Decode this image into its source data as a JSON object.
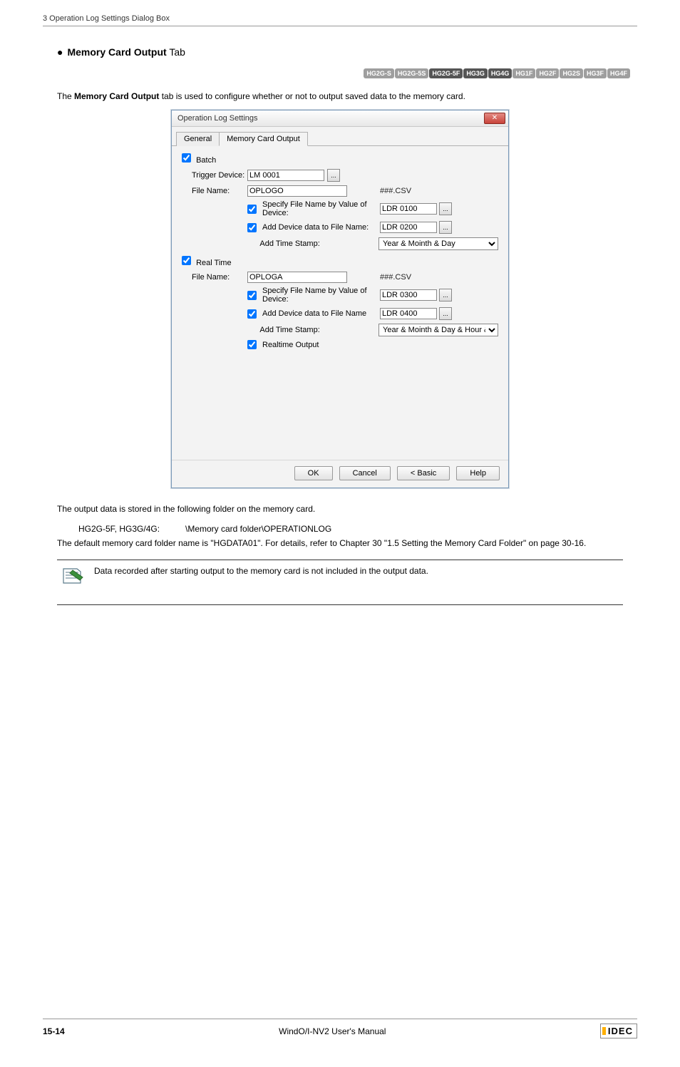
{
  "header": {
    "text": "3 Operation Log Settings Dialog Box"
  },
  "section": {
    "bullet": "●",
    "title_bold": "Memory Card Output",
    "title_rest": " Tab"
  },
  "badges": [
    {
      "label": "HG2G-S",
      "active": false
    },
    {
      "label": "HG2G-5S",
      "active": false
    },
    {
      "label": "HG2G-5F",
      "active": true
    },
    {
      "label": "HG3G",
      "active": true
    },
    {
      "label": "HG4G",
      "active": true
    },
    {
      "label": "HG1F",
      "active": false
    },
    {
      "label": "HG2F",
      "active": false
    },
    {
      "label": "HG2S",
      "active": false
    },
    {
      "label": "HG3F",
      "active": false
    },
    {
      "label": "HG4F",
      "active": false
    }
  ],
  "intro": {
    "pre": "The ",
    "bold": "Memory Card Output",
    "post": " tab is used to configure whether or not to output saved data to the memory card."
  },
  "dialog": {
    "title": "Operation Log Settings",
    "close_glyph": "✕",
    "tabs": {
      "general": "General",
      "memcard": "Memory Card Output"
    },
    "batch": {
      "head": "Batch",
      "trigger_label": "Trigger Device:",
      "trigger_value": "LM 0001",
      "file_label": "File Name:",
      "file_value": "OPLOGO",
      "ext": "###.CSV",
      "spec_label": "Specify File Name by Value of Device:",
      "spec_value": "LDR 0100",
      "add_label": "Add Device data to File Name:",
      "add_value": "LDR 0200",
      "stamp_label": "Add Time Stamp:",
      "stamp_value": "Year & Mointh & Day"
    },
    "realtime": {
      "head": "Real Time",
      "file_label": "File Name:",
      "file_value": "OPLOGA",
      "ext": "###.CSV",
      "spec_label": "Specify File Name by Value of Device:",
      "spec_value": "LDR 0300",
      "add_label": "Add Device data to File Name",
      "add_value": "LDR 0400",
      "stamp_label": "Add Time Stamp:",
      "stamp_value": "Year & Mointh & Day & Hour & Minute",
      "rt_output": "Realtime Output"
    },
    "buttons": {
      "ok": "OK",
      "cancel": "Cancel",
      "basic": "< Basic",
      "help": "Help"
    },
    "ellipsis": "..."
  },
  "after": {
    "line1": "The output data is stored in the following folder on the memory card.",
    "pair_k": "HG2G-5F, HG3G/4G:",
    "pair_v": "\\Memory card folder\\OPERATIONLOG",
    "line2": "The default memory card folder name is \"HGDATA01\". For details, refer to Chapter 30 \"1.5 Setting the Memory Card Folder\" on page 30-16.",
    "note": "Data recorded after starting output to the memory card is not included in the output data."
  },
  "footer": {
    "page": "15-14",
    "manual": "WindO/I-NV2 User's Manual",
    "brand": "IDEC"
  }
}
